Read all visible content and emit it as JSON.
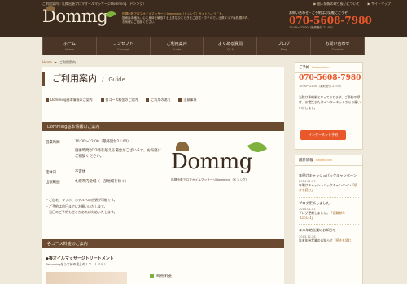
{
  "header": {
    "topline": "ご利用案内｜札幌出張アロマオイルマッサージDomming（ドンング）",
    "toplinks": [
      "▶ 個人情報の取り扱いについて",
      "▶ サイトマップ"
    ],
    "logo": "Dommg",
    "tagline_lead": "札幌出張アロマオイルマッサージ Domming（ドンング）サイトへようこそ。",
    "tagline_body": "施術は本格派。心と身体を解放する上質なひとときをご自宅・ホテルで。出張エリアは札幌市内、お気軽にご相談ください。",
    "contact_label": "お問い合わせ・ご予約はお気軽にどうぞ",
    "phone": "070-5608-7980",
    "hours": "10:00～22:00（最終受付 21:00）"
  },
  "nav": [
    {
      "jp": "ホーム",
      "en": "Home"
    },
    {
      "jp": "コンセプト",
      "en": "Concept"
    },
    {
      "jp": "ご利用案内",
      "en": "Guide"
    },
    {
      "jp": "よくある質問",
      "en": "Q&A"
    },
    {
      "jp": "ブログ",
      "en": "Blog"
    },
    {
      "jp": "お問い合わせ",
      "en": "Contact"
    }
  ],
  "breadcrumb": {
    "home": "Home",
    "sep": "▶",
    "current": "ご利用案内"
  },
  "main": {
    "title_jp": "ご利用案内",
    "title_sep": "/",
    "title_en": "Guide",
    "anchors": [
      "Domming基本情報のご案内",
      "各コース料金のご案内",
      "ご利用の流れ",
      "注意事項"
    ],
    "section1": "Domming基本情報のご案内",
    "info": [
      {
        "label": "営業時間",
        "value": "10:00～22:00（最終受付21:00）"
      },
      {
        "label": "",
        "value": "施術時間が22時を越える場合がございます。お気軽にご相談ください。"
      },
      {
        "label": "定休日",
        "value": "不定休"
      },
      {
        "label": "出張範囲",
        "value": "札幌市内全域（一部地域を除く）"
      }
    ],
    "notes": [
      "ご自宅、ラブホ、ホテルへの出張が可能です。",
      "ご予約は前日までにお願いいたします。",
      "当日のご予約も空きがあれば対応いたします。"
    ],
    "logo_text": "Dommg",
    "logo_caption": "札幌出張アロマオイルマッサージDomming（ドンング）",
    "section2": "各コース料金のご案内",
    "course_title": "◆香オイルマッサージトリートメント",
    "course_text": "Dommingならではの極上のトリートメント",
    "fee_label": "時間/料金"
  },
  "sidebar": {
    "reserve_title": "ご予約",
    "reserve_en": "Reservation",
    "phone": "070-5608-7980",
    "hours": "10:00～22:00（最終受付 21:00）",
    "text": "当院は予約制となっております。ご予約の際は、お電話またはインターネットからお願いいたします。",
    "button": "インターネット予約",
    "news_title": "最新情報",
    "news_en": "Information",
    "news": [
      {
        "title": "年明けキャッシュバックキャンペーン",
        "date": "2014.01.07",
        "body": "年明けキャッシュバックキャンペーン",
        "more": "続きを読む"
      },
      {
        "title": "ブログ更新しました。",
        "date": "2014.01.01",
        "body": "ブログ更新しました。「",
        "more": "謹賀新年【2014】"
      },
      {
        "title": "年末年始営業のお知らせ",
        "date": "2013.12.26",
        "body": "年末年始営業のお知らせ",
        "more": "続きを読む"
      }
    ]
  }
}
